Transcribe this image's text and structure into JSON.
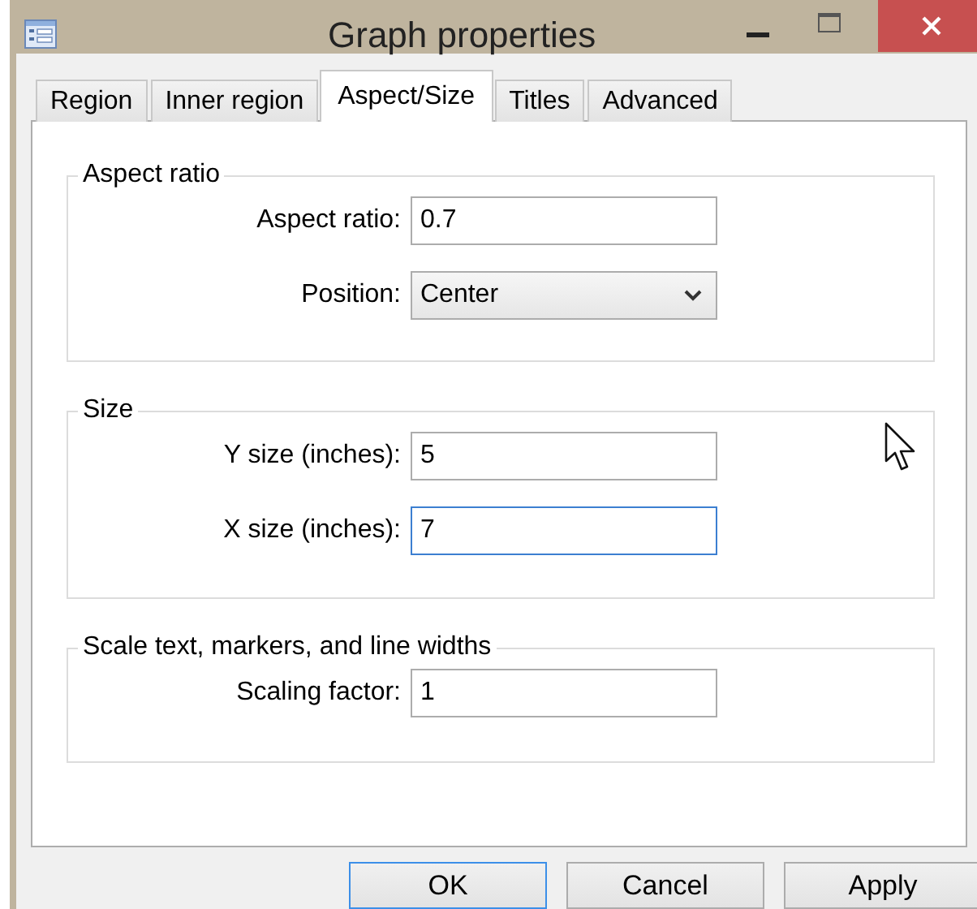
{
  "window": {
    "title": "Graph properties"
  },
  "tabs": [
    {
      "label": "Region",
      "selected": false
    },
    {
      "label": "Inner region",
      "selected": false
    },
    {
      "label": "Aspect/Size",
      "selected": true
    },
    {
      "label": "Titles",
      "selected": false
    },
    {
      "label": "Advanced",
      "selected": false
    }
  ],
  "groups": [
    {
      "title": "Aspect ratio",
      "fields": [
        {
          "kind": "text",
          "label": "Aspect ratio:",
          "value": "0.7",
          "focused": false
        },
        {
          "kind": "dropdown",
          "label": "Position:",
          "value": "Center",
          "focused": false
        }
      ]
    },
    {
      "title": "Size",
      "fields": [
        {
          "kind": "text",
          "label": "Y size (inches):",
          "value": "5",
          "focused": false
        },
        {
          "kind": "text",
          "label": "X size (inches):",
          "value": "7",
          "focused": true
        }
      ]
    },
    {
      "title": "Scale text, markers, and line widths",
      "fields": [
        {
          "kind": "text",
          "label": "Scaling factor:",
          "value": "1",
          "focused": false
        }
      ]
    }
  ],
  "buttons": [
    {
      "label": "OK",
      "default": true
    },
    {
      "label": "Cancel",
      "default": false
    },
    {
      "label": "Apply",
      "default": false
    }
  ]
}
